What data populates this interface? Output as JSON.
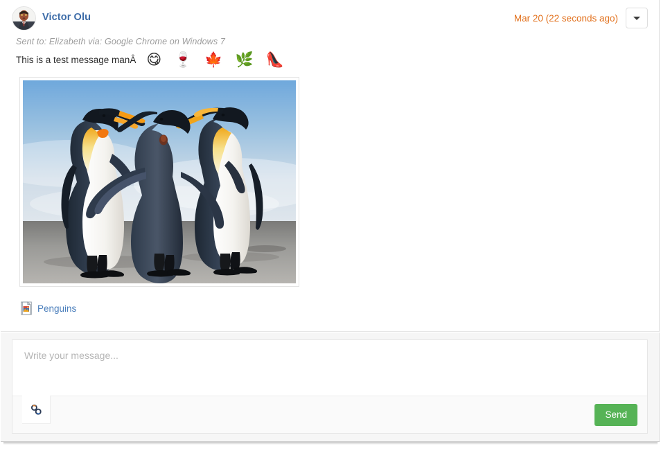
{
  "message": {
    "sender_name": "Victor Olu",
    "avatar_icon": "user-avatar-photo",
    "timestamp": "Mar 20 (22 seconds ago)",
    "timestamp_color": "#e2711d",
    "sender_name_color": "#3d6ca8",
    "options_icon": "chevron-down-icon",
    "sent_via": "Sent to: Elizabeth via: Google Chrome on Windows 7",
    "body_text": "This is a test message manÂ",
    "emojis": [
      {
        "glyph": "😋",
        "name": "face-savoring-food-emoji"
      },
      {
        "glyph": "🍷",
        "name": "wine-glass-emoji"
      },
      {
        "glyph": "🍁",
        "name": "maple-leaf-emoji"
      },
      {
        "glyph": "🌿",
        "name": "herb-emoji"
      },
      {
        "glyph": "👠",
        "name": "high-heeled-shoe-emoji"
      }
    ],
    "inline_image_alt": "Three king penguins standing on a beach",
    "attachment": {
      "icon": "image-file-icon",
      "name": "Penguins",
      "link_color": "#4a7ebb"
    }
  },
  "composer": {
    "placeholder": "Write your message...",
    "value": "",
    "attach_icon": "link-chain-icon",
    "send_label": "Send",
    "send_color": "#56b356"
  }
}
